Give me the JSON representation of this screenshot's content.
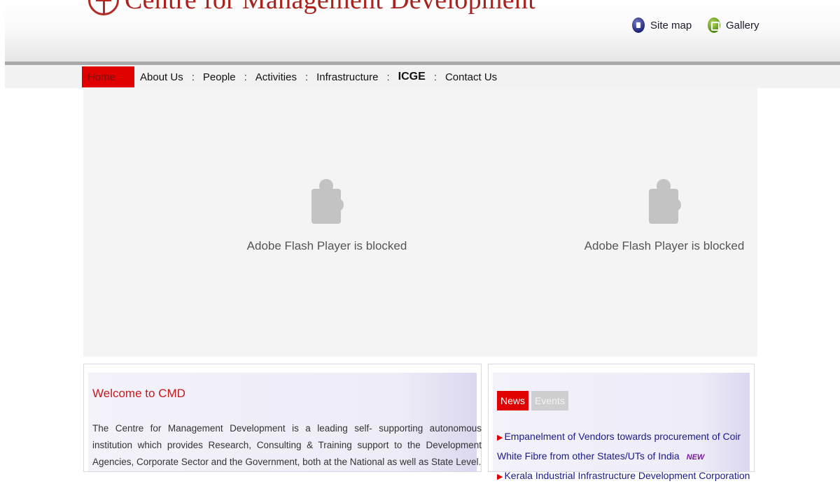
{
  "header": {
    "site_title": "Centre for Management Development",
    "links": [
      {
        "label": "Site map",
        "icon": "sitemap-icon"
      },
      {
        "label": "Gallery",
        "icon": "gallery-icon"
      }
    ]
  },
  "nav": {
    "items": [
      "Home",
      "About Us",
      "People",
      "Activities",
      "Infrastructure",
      "ICGE",
      "Contact Us"
    ],
    "separator": ":",
    "active": "Home"
  },
  "flash": {
    "message_left": "Adobe Flash Player is blocked",
    "message_right": "Adobe Flash Player is blocked",
    "icon": "puzzle-plugin-icon"
  },
  "welcome": {
    "title": "Welcome to CMD",
    "text": "The Centre for Management Development is a leading self- supporting autonomous institution which provides Research, Consulting & Training support to the Development Agencies, Corporate Sector and the Government, both at the National as well as State Level."
  },
  "news_panel": {
    "tabs": [
      "News",
      "Events"
    ],
    "active_tab": "News",
    "items": [
      {
        "text": "Empanelment of Vendors towards procurement of Coir White Fibre from other States/UTs of India",
        "badge": "NEW"
      },
      {
        "text": "Kerala Industrial Infrastructure Development Corporation",
        "badge": ""
      }
    ]
  },
  "colors": {
    "brand_red": "#a8231e",
    "nav_active": "#e00000",
    "link_blue": "#1a1a8c"
  }
}
